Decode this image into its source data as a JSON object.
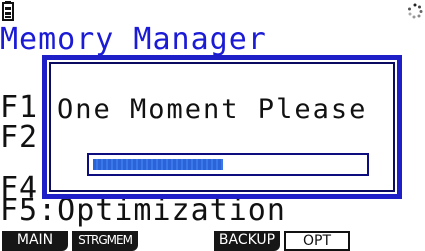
{
  "background": {
    "title": "Memory Manager",
    "line_f1": "F1",
    "line_f2": "F2",
    "line_f4": "F4",
    "line_f5": "F5:Optimization"
  },
  "dialog": {
    "message": "One Moment Please",
    "progress": 0.48
  },
  "function_keys": [
    "MAIN",
    "STRGMEM",
    "",
    "BACKUP",
    "OPT",
    ""
  ],
  "icons": {
    "status_left": "battery-icon",
    "status_right": "busy-icon"
  },
  "colors": {
    "title_text": "#1b1bd6",
    "dialog_border": "#1f1fc8",
    "progress_fill": "#2f6de0"
  }
}
